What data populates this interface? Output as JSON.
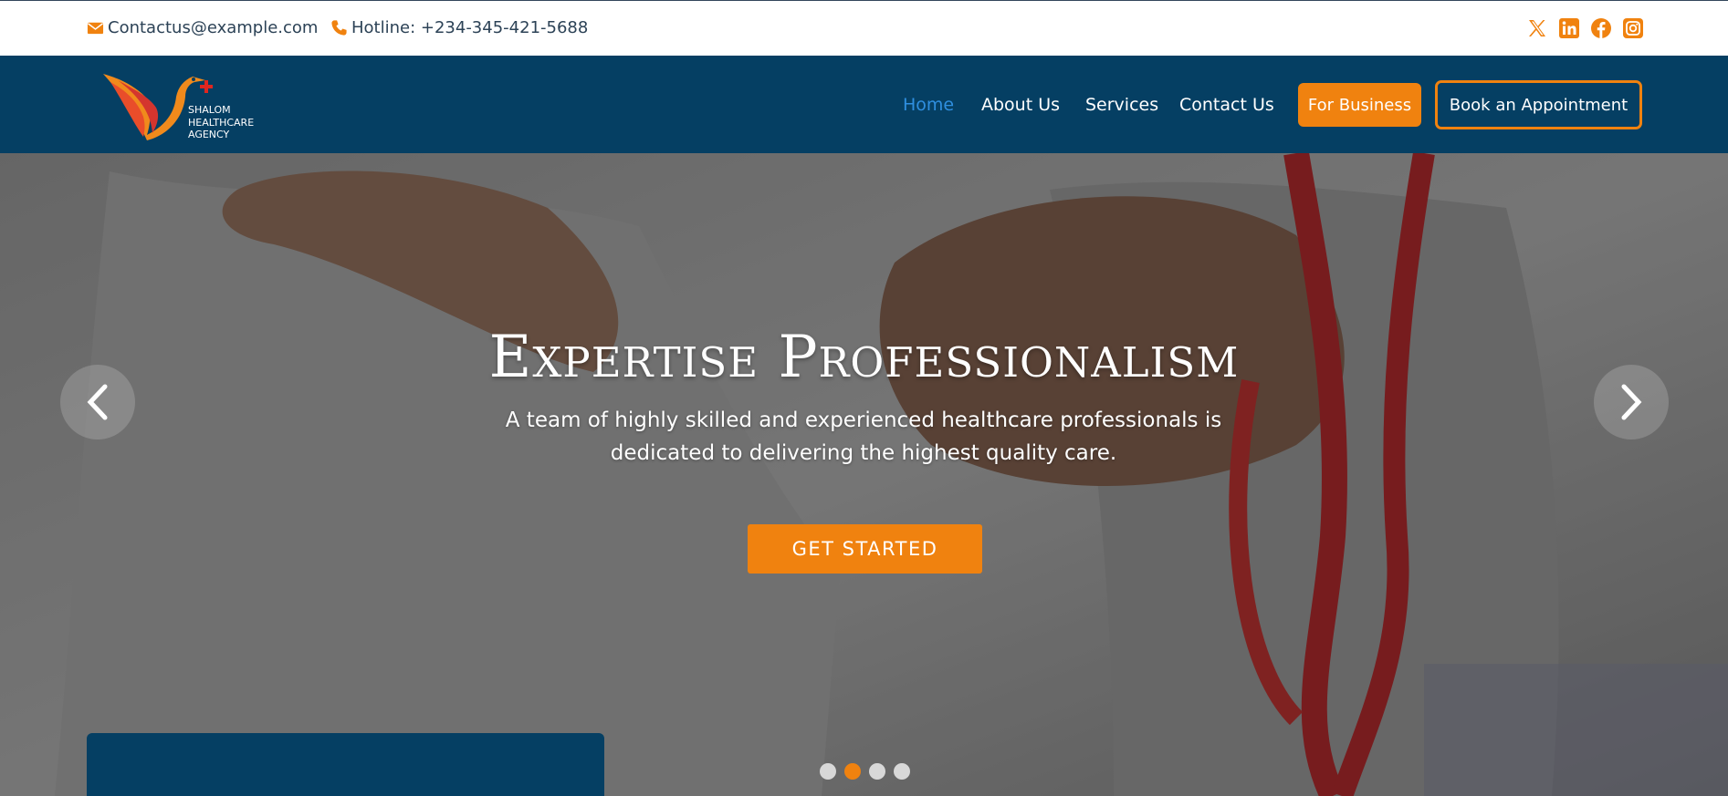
{
  "topbar": {
    "email": "Contactus@example.com",
    "hotline": "Hotline: +234-345-421-5688",
    "icons": [
      "envelope-icon",
      "phone-icon"
    ],
    "social": [
      "x-twitter-icon",
      "linkedin-icon",
      "facebook-icon",
      "instagram-icon"
    ]
  },
  "nav": {
    "logo_text": "SHALOM\nHEALTHCARE\nAGENCY",
    "items": [
      {
        "label": "Home"
      },
      {
        "label": "About Us"
      },
      {
        "label": "Services"
      },
      {
        "label": "Contact Us"
      }
    ],
    "business_button": "For Business",
    "appointment_button": "Book an Appointment"
  },
  "hero": {
    "title": "Expertise Professionalism",
    "subtitle": "A team of highly skilled and experienced healthcare professionals is dedicated to delivering the highest quality care.",
    "cta": "GET STARTED",
    "slides_count": 4,
    "active_slide": 2
  },
  "colors": {
    "navy": "#053f63",
    "orange": "#f0820f",
    "active_link": "#2f8fe0",
    "topbar_text": "#2c4256"
  }
}
